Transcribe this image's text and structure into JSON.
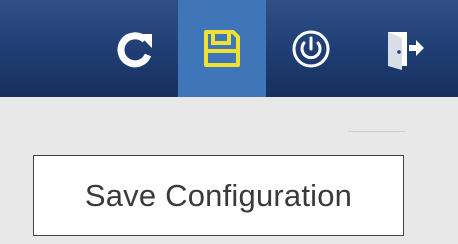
{
  "toolbar": {
    "buttons": [
      {
        "id": "refresh",
        "icon": "refresh-icon"
      },
      {
        "id": "save",
        "icon": "floppy-disk-icon",
        "active": true
      },
      {
        "id": "power",
        "icon": "power-icon"
      },
      {
        "id": "exit",
        "icon": "exit-door-icon"
      }
    ],
    "colors": {
      "bar": "#1f3d73",
      "active": "#3f75b9",
      "save_icon": "#f0e030",
      "icon": "#ffffff"
    }
  },
  "tooltip": {
    "text": "Save Configuration"
  }
}
